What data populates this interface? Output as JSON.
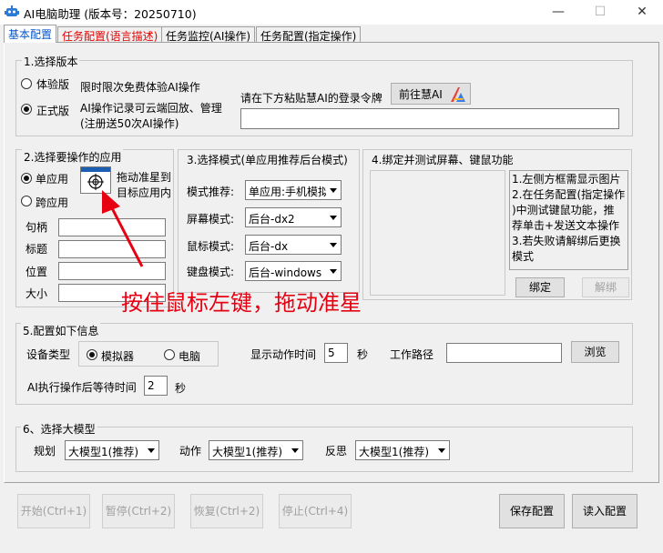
{
  "window": {
    "title": "AI电脑助理 (版本号：20250710)",
    "minimize": "—",
    "maximize": "☐",
    "close": "✕"
  },
  "tabs": [
    "基本配置",
    "任务配置(语言描述)",
    "任务监控(AI操作)",
    "任务配置(指定操作)"
  ],
  "version": {
    "title": "1.选择版本",
    "trial_label": "体验版",
    "trial_desc": "限时限次免费体验AI操作",
    "pro_label": "正式版",
    "pro_desc_1": "AI操作记录可云端回放、管理",
    "pro_desc_2": "(注册送50次AI操作)",
    "token_prompt": "请在下方粘贴慧AI的登录令牌",
    "goto_button": "前往慧AI",
    "token_value": ""
  },
  "app": {
    "title": "2.选择要操作的应用",
    "single_label": "单应用",
    "cross_label": "跨应用",
    "drag_hint_1": "拖动准星到",
    "drag_hint_2": "目标应用内",
    "fields": {
      "handle_label": "句柄",
      "handle_value": "",
      "title_label": "标题",
      "title_value": "",
      "position_label": "位置",
      "position_value": "",
      "size_label": "大小",
      "size_value": ""
    }
  },
  "annotation": {
    "text": "按住鼠标左键，拖动准星",
    "color": "#e60012"
  },
  "mode": {
    "title": "3.选择模式(单应用推荐后台模式)",
    "recommend_label": "模式推荐:",
    "recommend_value": "单应用:手机模拟",
    "screen_label": "屏幕模式:",
    "screen_value": "后台-dx2",
    "mouse_label": "鼠标模式:",
    "mouse_value": "后台-dx",
    "keyboard_label": "键盘模式:",
    "keyboard_value": "后台-windows"
  },
  "bind": {
    "title": "4.绑定并测试屏幕、键鼠功能",
    "info": [
      "1.左侧方框需显示图片",
      "2.在任务配置(指定操作",
      ")中测试键鼠功能，推",
      "荐单击+发送文本操作",
      "3.若失败请解绑后更换",
      "模式"
    ],
    "bind_button": "绑定",
    "unbind_button": "解绑"
  },
  "config": {
    "title": "5.配置如下信息",
    "device_label": "设备类型",
    "emulator_label": "模拟器",
    "pc_label": "电脑",
    "show_time_label": "显示动作时间",
    "show_time_value": "5",
    "show_time_unit": "秒",
    "work_path_label": "工作路径",
    "work_path_value": "",
    "browse_button": "浏览",
    "wait_label": "AI执行操作后等待时间",
    "wait_value": "2",
    "wait_unit": "秒"
  },
  "model": {
    "title": "6、选择大模型",
    "plan_label": "规划",
    "plan_value": "大模型1(推荐)",
    "action_label": "动作",
    "action_value": "大模型1(推荐)",
    "reflect_label": "反思",
    "reflect_value": "大模型1(推荐)"
  },
  "footer": {
    "start": "开始(Ctrl+1)",
    "pause": "暂停(Ctrl+2)",
    "resume": "恢复(Ctrl+2)",
    "stop": "停止(Ctrl+4)",
    "save": "保存配置",
    "load": "读入配置"
  },
  "colors": {
    "active_tab": "#0a56c8",
    "red_tab": "#e60000",
    "background": "#f0f0f0"
  }
}
